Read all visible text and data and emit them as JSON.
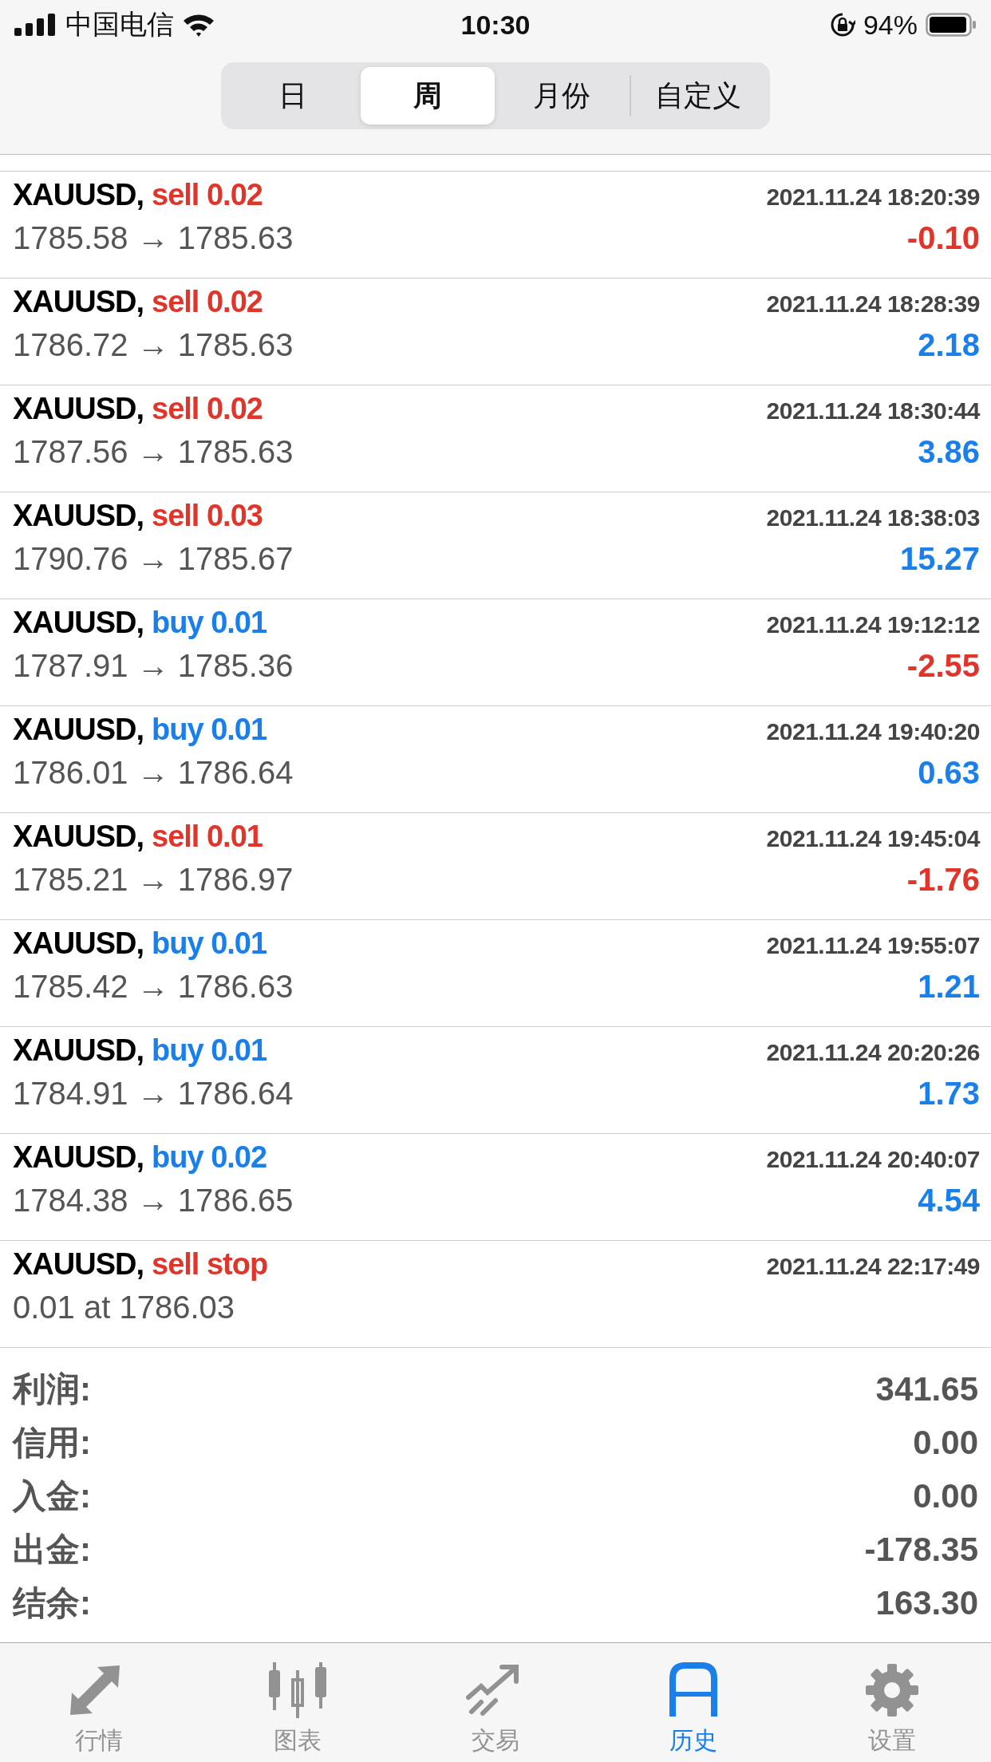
{
  "status_bar": {
    "carrier": "中国电信",
    "time": "10:30",
    "battery": "94%"
  },
  "tabs": [
    {
      "label": "日",
      "selected": false
    },
    {
      "label": "周",
      "selected": true
    },
    {
      "label": "月份",
      "selected": false
    },
    {
      "label": "自定义",
      "selected": false
    }
  ],
  "rows": [
    {
      "kind": "deal",
      "symbol": "XAUUSD,",
      "action": {
        "text": "sell 0.02",
        "color": "#e0352b"
      },
      "time": "2021.11.24 18:20:39",
      "prices": "1785.58 → 1785.63",
      "profit": {
        "text": "-0.10",
        "color": "#e0352b"
      }
    },
    {
      "kind": "deal",
      "symbol": "XAUUSD,",
      "action": {
        "text": "sell 0.02",
        "color": "#e0352b"
      },
      "time": "2021.11.24 18:28:39",
      "prices": "1786.72 → 1785.63",
      "profit": {
        "text": "2.18",
        "color": "#1a7fe8"
      }
    },
    {
      "kind": "deal",
      "symbol": "XAUUSD,",
      "action": {
        "text": "sell 0.02",
        "color": "#e0352b"
      },
      "time": "2021.11.24 18:30:44",
      "prices": "1787.56 → 1785.63",
      "profit": {
        "text": "3.86",
        "color": "#1a7fe8"
      }
    },
    {
      "kind": "deal",
      "symbol": "XAUUSD,",
      "action": {
        "text": "sell 0.03",
        "color": "#e0352b"
      },
      "time": "2021.11.24 18:38:03",
      "prices": "1790.76 → 1785.67",
      "profit": {
        "text": "15.27",
        "color": "#1a7fe8"
      }
    },
    {
      "kind": "deal",
      "symbol": "XAUUSD,",
      "action": {
        "text": "buy 0.01",
        "color": "#1a7fe8"
      },
      "time": "2021.11.24 19:12:12",
      "prices": "1787.91 → 1785.36",
      "profit": {
        "text": "-2.55",
        "color": "#e0352b"
      }
    },
    {
      "kind": "deal",
      "symbol": "XAUUSD,",
      "action": {
        "text": "buy 0.01",
        "color": "#1a7fe8"
      },
      "time": "2021.11.24 19:40:20",
      "prices": "1786.01 → 1786.64",
      "profit": {
        "text": "0.63",
        "color": "#1a7fe8"
      }
    },
    {
      "kind": "deal",
      "symbol": "XAUUSD,",
      "action": {
        "text": "sell 0.01",
        "color": "#e0352b"
      },
      "time": "2021.11.24 19:45:04",
      "prices": "1785.21 → 1786.97",
      "profit": {
        "text": "-1.76",
        "color": "#e0352b"
      }
    },
    {
      "kind": "deal",
      "symbol": "XAUUSD,",
      "action": {
        "text": "buy 0.01",
        "color": "#1a7fe8"
      },
      "time": "2021.11.24 19:55:07",
      "prices": "1785.42 → 1786.63",
      "profit": {
        "text": "1.21",
        "color": "#1a7fe8"
      }
    },
    {
      "kind": "deal",
      "symbol": "XAUUSD,",
      "action": {
        "text": "buy 0.01",
        "color": "#1a7fe8"
      },
      "time": "2021.11.24 20:20:26",
      "prices": "1784.91 → 1786.64",
      "profit": {
        "text": "1.73",
        "color": "#1a7fe8"
      }
    },
    {
      "kind": "deal",
      "symbol": "XAUUSD,",
      "action": {
        "text": "buy 0.02",
        "color": "#1a7fe8"
      },
      "time": "2021.11.24 20:40:07",
      "prices": "1784.38 → 1786.65",
      "profit": {
        "text": "4.54",
        "color": "#1a7fe8"
      }
    },
    {
      "kind": "order",
      "symbol": "XAUUSD,",
      "action": {
        "text": "sell stop",
        "color": "#e0352b"
      },
      "time": "2021.11.24 22:17:49",
      "prices": "0.01 at 1786.03"
    }
  ],
  "summary": [
    {
      "label": "利润:",
      "value": "341.65"
    },
    {
      "label": "信用:",
      "value": "0.00"
    },
    {
      "label": "入金:",
      "value": "0.00"
    },
    {
      "label": "出金:",
      "value": "-178.35"
    },
    {
      "label": "结余:",
      "value": "163.30"
    }
  ],
  "tab_bar": [
    {
      "kind": "quotes",
      "label": "行情",
      "selected": false
    },
    {
      "kind": "chart",
      "label": "图表",
      "selected": false
    },
    {
      "kind": "trade",
      "label": "交易",
      "selected": false
    },
    {
      "kind": "history",
      "label": "历史",
      "selected": true
    },
    {
      "kind": "settings",
      "label": "设置",
      "selected": false
    }
  ]
}
